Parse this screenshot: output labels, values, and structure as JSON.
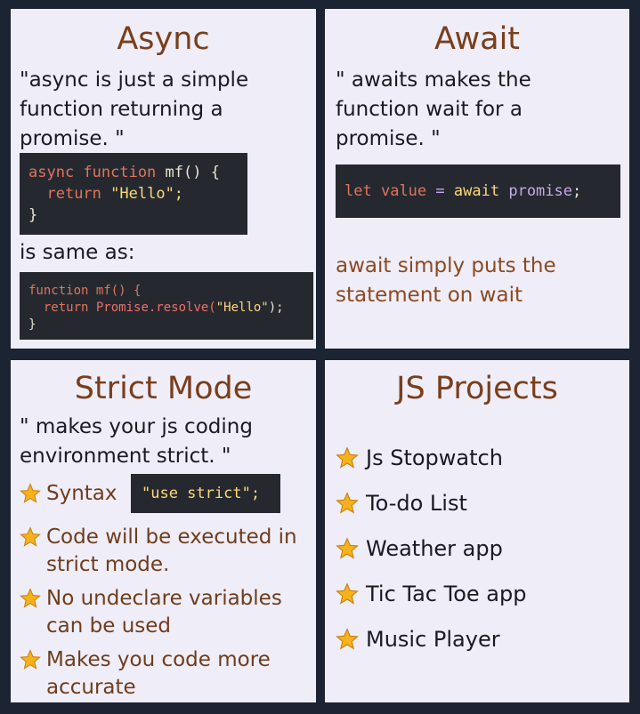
{
  "async": {
    "title": "Async",
    "description": "\"async is just a simple function returning a promise. \"",
    "code1": {
      "line1_kw": "async function",
      "line1_fn": "mf() {",
      "line2_kw": "return",
      "line2_str": "\"Hello\";",
      "line3": "}"
    },
    "same_as": "is same as:",
    "code2": {
      "line1": "function mf() {",
      "line2_kw": "return",
      "line2_promise": "Promise.resolve(",
      "line2_str": "\"Hello\"",
      "line2_end": ");",
      "line3": "}"
    }
  },
  "await": {
    "title": "Await",
    "description": "\" awaits makes the function wait for a promise. \"",
    "code": {
      "let": "let",
      "value": "value",
      "eq": "=",
      "await": "await",
      "promise": "promise",
      "semi": ";"
    },
    "note": "await simply puts the statement on wait"
  },
  "strict": {
    "title": "Strict Mode",
    "description": "\" makes your js coding environment strict. \"",
    "syntax_label": "Syntax",
    "syntax_code": "\"use strict\";",
    "items": [
      "Code will be executed in strict mode.",
      "No undeclare variables can be used",
      "Makes you code more accurate"
    ]
  },
  "projects": {
    "title": "JS Projects",
    "items": [
      "Js Stopwatch",
      "To-do List",
      "Weather app",
      "Tic Tac Toe app",
      "Music Player"
    ]
  },
  "colors": {
    "background": "#1c2333",
    "panel": "#efedf8",
    "title": "#7a3e1b",
    "code_bg": "#25292f",
    "star": "#f5b21c"
  },
  "icons": {
    "bullet": "star-icon"
  }
}
